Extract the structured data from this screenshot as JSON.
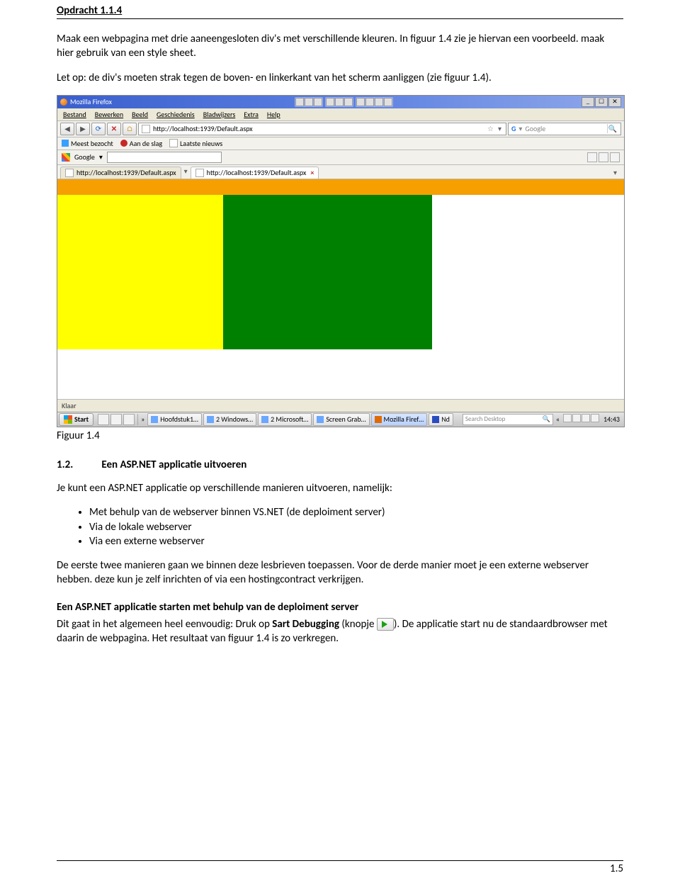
{
  "header": {
    "title": "Opdracht 1.1.4"
  },
  "intro": {
    "p1": "Maak een webpagina met drie aaneengesloten div's met verschillende kleuren. In figuur 1.4 zie je hiervan een voorbeeld. maak hier gebruik van een style sheet.",
    "p2": "Let op: de div's moeten strak tegen de boven- en linkerkant van het scherm aanliggen (zie figuur 1.4)."
  },
  "browser": {
    "title": "Mozilla Firefox",
    "menu": [
      "Bestand",
      "Bewerken",
      "Beeld",
      "Geschiedenis",
      "Bladwijzers",
      "Extra",
      "Help"
    ],
    "url": "http://localhost:1939/Default.aspx",
    "search_engine": "Google",
    "search_placeholder": "Google",
    "bookmarks": {
      "label": "Meest bezocht",
      "items": [
        "Aan de slag",
        "Laatste nieuws"
      ]
    },
    "google_toolbar": "Google",
    "tabs": [
      {
        "label": "http://localhost:1939/Default.aspx",
        "active": false
      },
      {
        "label": "http://localhost:1939/Default.aspx",
        "active": true
      }
    ],
    "status": "Klaar",
    "taskbar": {
      "start": "Start",
      "tasks": [
        "Hoofdstuk1…",
        "2 Windows…",
        "2 Microsoft…",
        "Screen Grab…",
        "Mozilla Firef…",
        "Nd"
      ],
      "search": "Search Desktop",
      "clock": "14:43"
    }
  },
  "fig_caption": "Figuur 1.4",
  "section": {
    "num": "1.2.",
    "title": "Een ASP.NET applicatie uitvoeren"
  },
  "body": {
    "p1": "Je kunt een ASP.NET applicatie op verschillende manieren uitvoeren, namelijk:",
    "bullets": [
      "Met behulp van de webserver binnen VS.NET (de deploiment server)",
      "Via de lokale webserver",
      "Via een externe webserver"
    ],
    "p2": "De eerste twee manieren gaan we binnen deze lesbrieven toepassen. Voor de derde manier moet je een externe webserver hebben. deze kun je zelf inrichten of via een hostingcontract verkrijgen.",
    "sub_h": "Een ASP.NET applicatie starten met behulp van de deploiment server",
    "p3a": "Dit gaat in het algemeen heel eenvoudig: Druk op ",
    "p3b": "Sart Debugging",
    "p3c": " (knopje ",
    "p3d": "). De applicatie start nu de standaardbrowser met daarin de webpagina. Het resultaat van figuur 1.4 is zo verkregen."
  },
  "footer": "1.5"
}
